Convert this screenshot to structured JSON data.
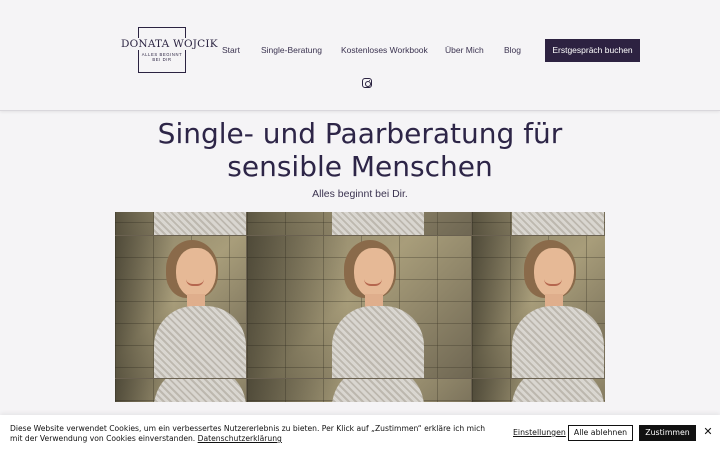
{
  "header": {
    "logo": {
      "name": "DONATA WOJCIK",
      "tagline": "ALLES BEGINNT BEI DIR"
    },
    "nav": [
      {
        "label": "Start"
      },
      {
        "label": "Single-Beratung"
      },
      {
        "label": "Kostenloses Workbook"
      },
      {
        "label": "Über Mich"
      },
      {
        "label": "Blog"
      }
    ],
    "cta_label": "Erstgespräch buchen",
    "social_icon": "instagram-icon"
  },
  "hero": {
    "title_line1": "Single- und Paarberatung für",
    "title_line2": "sensible Menschen",
    "subtitle": "Alles beginnt bei Dir."
  },
  "cookie_banner": {
    "text": "Diese Website verwendet Cookies, um ein verbessertes Nutzererlebnis zu bieten. Per Klick auf „Zustimmen“ erkläre ich mich mit der Verwendung von Cookies einverstanden.",
    "privacy_link": "Datenschutzerklärung",
    "settings_label": "Einstellungen",
    "reject_label": "Alle ablehnen",
    "accept_label": "Zustimmen",
    "close_icon": "close-icon"
  },
  "colors": {
    "brand": "#2d2241",
    "background": "#f5f4f6",
    "cookie_accept": "#111111"
  }
}
